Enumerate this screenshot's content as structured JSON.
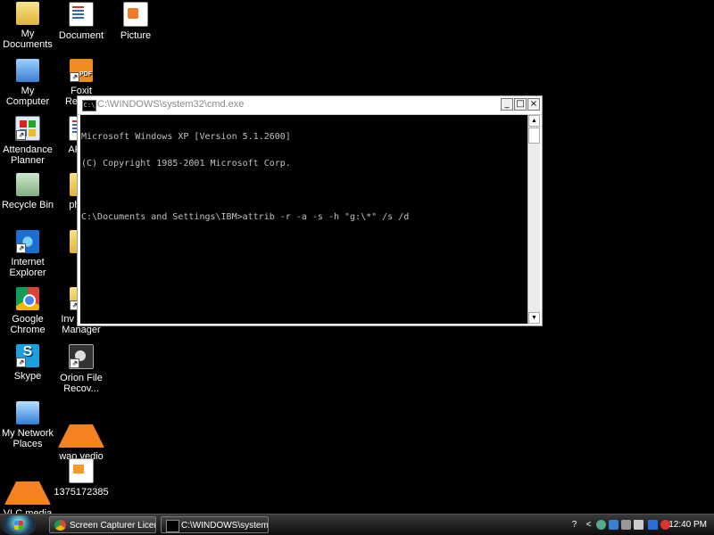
{
  "desktop": {
    "icons": [
      {
        "label": "My Documents"
      },
      {
        "label": "Document"
      },
      {
        "label": "Picture"
      },
      {
        "label": "My Computer"
      },
      {
        "label": "Foxit Reader"
      },
      {
        "label": "Attendance Planner"
      },
      {
        "label": "APlan"
      },
      {
        "label": "Recycle Bin"
      },
      {
        "label": "photo"
      },
      {
        "label": "Internet Explorer"
      },
      {
        "label": "ka"
      },
      {
        "label": "Google Chrome"
      },
      {
        "label": "Inv Stock Manager"
      },
      {
        "label": "Skype"
      },
      {
        "label": "Orion File Recov..."
      },
      {
        "label": "My Network Places"
      },
      {
        "label": "wao vedio"
      },
      {
        "label": "VLC media player"
      },
      {
        "label": "1375172385"
      }
    ]
  },
  "cmd": {
    "title": "C:\\WINDOWS\\system32\\cmd.exe",
    "icon_text": "C:\\",
    "lines": [
      "Microsoft Windows XP [Version 5.1.2600]",
      "(C) Copyright 1985-2001 Microsoft Corp.",
      "",
      "C:\\Documents and Settings\\IBM>attrib -r -a -s -h \"g:\\*\" /s /d"
    ],
    "buttons": {
      "minimize": "_",
      "maximize": "□",
      "close": "×"
    },
    "scroll": {
      "up": "▲",
      "down": "▼"
    }
  },
  "taskbar": {
    "tasks": [
      {
        "label": "Screen Capturer Licen..."
      },
      {
        "label": "C:\\WINDOWS\\system..."
      }
    ],
    "tray": {
      "help": "?",
      "collapse": "<"
    },
    "clock": "12:40 PM"
  }
}
